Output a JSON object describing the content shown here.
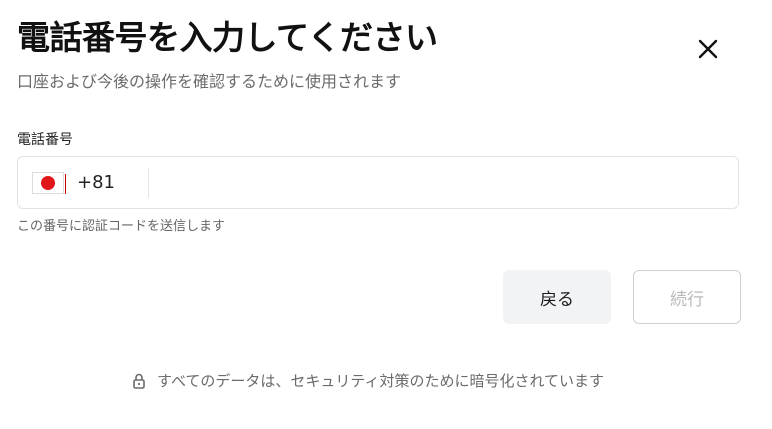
{
  "dialog": {
    "title": "電話番号を入力してください",
    "subtitle": "口座および今後の操作を確認するために使用されます",
    "close_icon": "close-icon"
  },
  "phone": {
    "label": "電話番号",
    "country_flag": "japan-flag-icon",
    "dial_code": "+81",
    "value": "",
    "placeholder": "",
    "hint": "この番号に認証コードを送信します"
  },
  "actions": {
    "back_label": "戻る",
    "continue_label": "続行"
  },
  "footer": {
    "security_text": "すべてのデータは、セキュリティ対策のために暗号化されています",
    "icon": "lock-icon"
  },
  "colors": {
    "flag_red": "#e0161b",
    "back_button_bg": "#f2f3f5",
    "continue_text_disabled": "#b9b9b9"
  }
}
